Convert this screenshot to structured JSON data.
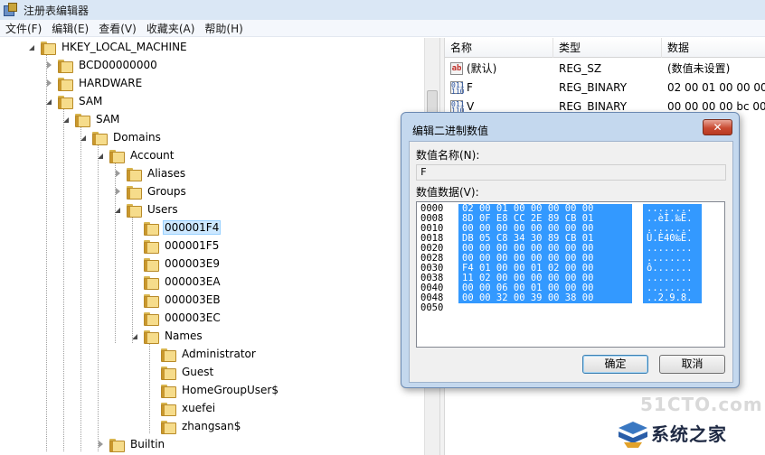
{
  "window": {
    "title": "注册表编辑器",
    "icon": "registry-editor-icon"
  },
  "menu": [
    "文件(F)",
    "编辑(E)",
    "查看(V)",
    "收藏夹(A)",
    "帮助(H)"
  ],
  "tree": {
    "root": "HKEY_LOCAL_MACHINE",
    "items": {
      "bcd": "BCD00000000",
      "hardware": "HARDWARE",
      "sam": "SAM",
      "sam2": "SAM",
      "domains": "Domains",
      "account": "Account",
      "aliases": "Aliases",
      "groups": "Groups",
      "users": "Users",
      "u1": "000001F4",
      "u2": "000001F5",
      "u3": "000003E9",
      "u4": "000003EA",
      "u5": "000003EB",
      "u6": "000003EC",
      "names": "Names",
      "n1": "Administrator",
      "n2": "Guest",
      "n3": "HomeGroupUser$",
      "n4": "xuefei",
      "n5": "zhangsan$",
      "builtin": "Builtin"
    }
  },
  "list": {
    "headers": {
      "name": "名称",
      "type": "类型",
      "data": "数据"
    },
    "rows": [
      {
        "name": "(默认)",
        "type": "REG_SZ",
        "data": "(数值未设置)",
        "icon": "string-value-icon"
      },
      {
        "name": "F",
        "type": "REG_BINARY",
        "data": "02 00 01 00 00 00 00",
        "icon": "binary-value-icon"
      },
      {
        "name": "V",
        "type": "REG_BINARY",
        "data": "00 00 00 00 bc 00",
        "icon": "binary-value-icon"
      }
    ]
  },
  "dialog": {
    "title": "编辑二进制数值",
    "close": "✕",
    "name_label": "数值名称(N):",
    "name_value": "F",
    "data_label": "数值数据(V):",
    "hex": [
      {
        "off": "0000",
        "bytes": "02 00 01 00 00 00 00 00",
        "ascii": "........"
      },
      {
        "off": "0008",
        "bytes": "8D 0F E8 CC 2E 89 CB 01",
        "ascii": "..èÌ.‰Ë."
      },
      {
        "off": "0010",
        "bytes": "00 00 00 00 00 00 00 00",
        "ascii": "........"
      },
      {
        "off": "0018",
        "bytes": "DB 05 C8 34 30 89 CB 01",
        "ascii": "Û.È40‰Ë."
      },
      {
        "off": "0020",
        "bytes": "00 00 00 00 00 00 00 00",
        "ascii": "........"
      },
      {
        "off": "0028",
        "bytes": "00 00 00 00 00 00 00 00",
        "ascii": "........"
      },
      {
        "off": "0030",
        "bytes": "F4 01 00 00 01 02 00 00",
        "ascii": "ô......."
      },
      {
        "off": "0038",
        "bytes": "11 02 00 00 00 00 00 00",
        "ascii": "........"
      },
      {
        "off": "0040",
        "bytes": "00 00 06 00 01 00 00 00",
        "ascii": "........"
      },
      {
        "off": "0048",
        "bytes": "00 00 32 00 39 00 38 00",
        "ascii": "..2.9.8."
      },
      {
        "off": "0050",
        "bytes": "",
        "ascii": ""
      }
    ],
    "ok": "确定",
    "cancel": "取消"
  },
  "watermark": {
    "site": "51CTO.com",
    "brand": "系统之家"
  }
}
